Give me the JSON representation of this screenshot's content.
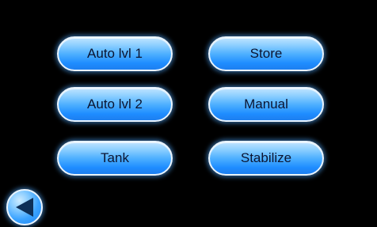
{
  "buttons": {
    "auto_lvl_1": "Auto lvl 1",
    "store": "Store",
    "auto_lvl_2": "Auto lvl 2",
    "manual": "Manual",
    "tank": "Tank",
    "stabilize": "Stabilize"
  },
  "icons": {
    "back": "back-arrow-icon"
  },
  "colors": {
    "background": "#000000",
    "button_blue": "#1e8cff",
    "button_highlight": "#bfe3ff",
    "button_border": "#e9f4ff",
    "button_text": "#0b1530",
    "back_arrow": "#0e2f57"
  }
}
